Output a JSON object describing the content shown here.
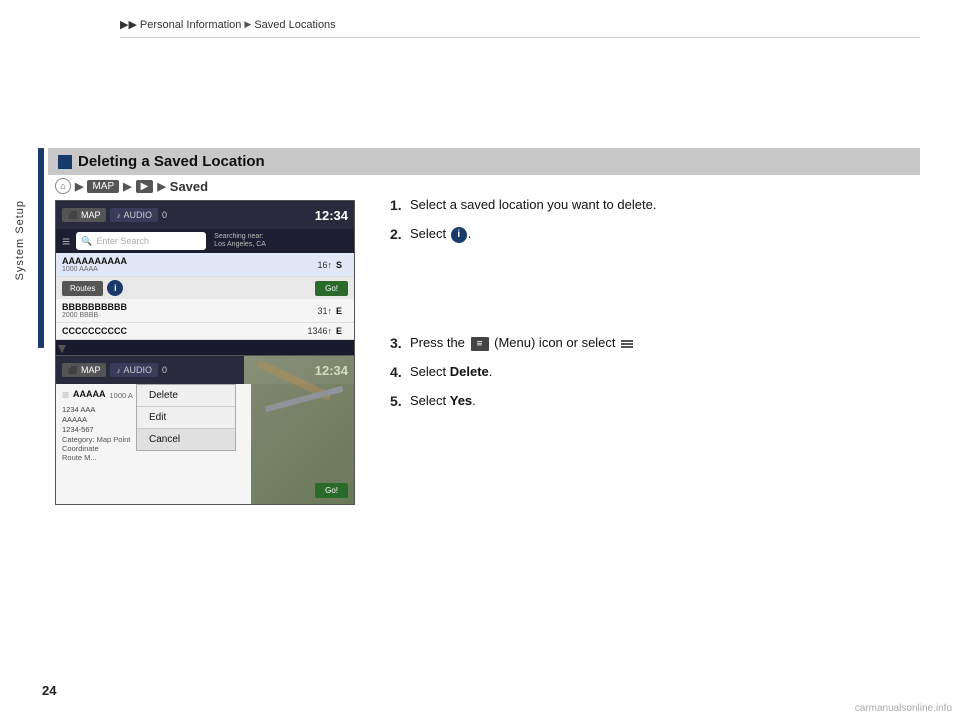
{
  "breadcrumb": {
    "arrows": "▶▶",
    "part1": "Personal Information",
    "sep1": "▶",
    "part2": "Saved Locations"
  },
  "sidebar": {
    "label": "System Setup"
  },
  "section": {
    "title": "Deleting a Saved Location",
    "nav_path": "Saved"
  },
  "screen1": {
    "tabs": [
      "MAP",
      "AUDIO"
    ],
    "time": "12:34",
    "signal_text": "0",
    "search_placeholder": "Enter Search",
    "search_location": "Searching near:\nLos Angeles, CA",
    "locations": [
      {
        "name": "AAAAAAAAAA",
        "sub": "1000 AAAA",
        "dist": "16↑",
        "dir": "S"
      },
      {
        "name": "BBBBBBBBBB",
        "sub": "2000 BBBB",
        "dist": "31↑",
        "dir": "E"
      },
      {
        "name": "CCCCCCCCCC",
        "sub": "",
        "dist": "1346↑",
        "dir": "E"
      }
    ],
    "routes_btn": "Routes",
    "go_btn": "Go!",
    "info_btn": "i"
  },
  "screen2": {
    "tabs": [
      "MAP",
      "AUDIO"
    ],
    "time": "12:34",
    "signal_text": "0",
    "location_name": "AAAAA",
    "location_sub": "1000 A",
    "addr_lines": [
      "1234 AAA",
      "AAAAA",
      "1234-567"
    ],
    "category_label": "Category:",
    "category_value": "Map Point",
    "coord_label": "Coordinate",
    "route_label": "Route M...",
    "menu_items": [
      "Delete",
      "Edit",
      "Cancel"
    ],
    "go_btn": "Go!"
  },
  "instructions": {
    "steps": [
      {
        "num": "1.",
        "text": "Select a saved location you want to delete."
      },
      {
        "num": "2.",
        "text": "Select {info}."
      },
      {
        "num": "3.",
        "text": "Press the {menu} (Menu) icon or select {menu_small}"
      },
      {
        "num": "4.",
        "text": "Select Delete."
      },
      {
        "num": "5.",
        "text": "Select Yes."
      }
    ]
  },
  "page": {
    "number": "24"
  },
  "watermark": {
    "text": "carmanualsonline.info"
  }
}
